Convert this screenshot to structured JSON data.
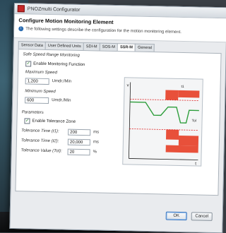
{
  "window": {
    "title": "PNOZmulti Configurator"
  },
  "header": {
    "heading": "Configure Motion Monitoring Element",
    "description": "The following settings describe the configuration for the motion monitoring element."
  },
  "tabs": [
    {
      "label": "Sensor Data"
    },
    {
      "label": "User Defined Units"
    },
    {
      "label": "SDI-M"
    },
    {
      "label": "SOS-M"
    },
    {
      "label": "SSR-M"
    },
    {
      "label": "General"
    }
  ],
  "active_tab": "SSR-M",
  "form": {
    "section_title": "Safe Speed Range Monitoring",
    "enable_monitoring_label": "Enable Monitoring Function",
    "enable_monitoring_checked": true,
    "max_speed_label": "Maximum Speed",
    "max_speed_value": "1,200",
    "max_speed_unit": "Umdr./Min",
    "min_speed_label": "Minimum Speed",
    "min_speed_value": "600",
    "min_speed_unit": "Umdr./Min",
    "parameters_label": "Parameters",
    "enable_tolerance_label": "Enable Tolerance Zone",
    "enable_tolerance_checked": true,
    "tol_time1_label": "Tolerance Time (t1):",
    "tol_time1_value": "200",
    "tol_time1_unit": "ms",
    "tol_time2_label": "Tolerance Time (t2):",
    "tol_time2_value": "20,000",
    "tol_time2_unit": "ms",
    "tol_value_label": "Tolerance Value (Tol):",
    "tol_value_value": "20",
    "tol_value_unit": "%"
  },
  "diagram": {
    "v_axis_label": "v",
    "t_axis_label": "t",
    "label_t1": "t1",
    "label_tol": "Tol",
    "colors": {
      "zone": "#e8503a",
      "curve": "#2e9e3c",
      "limit": "#e02020"
    }
  },
  "buttons": {
    "ok": "OK",
    "cancel": "Cancel"
  }
}
